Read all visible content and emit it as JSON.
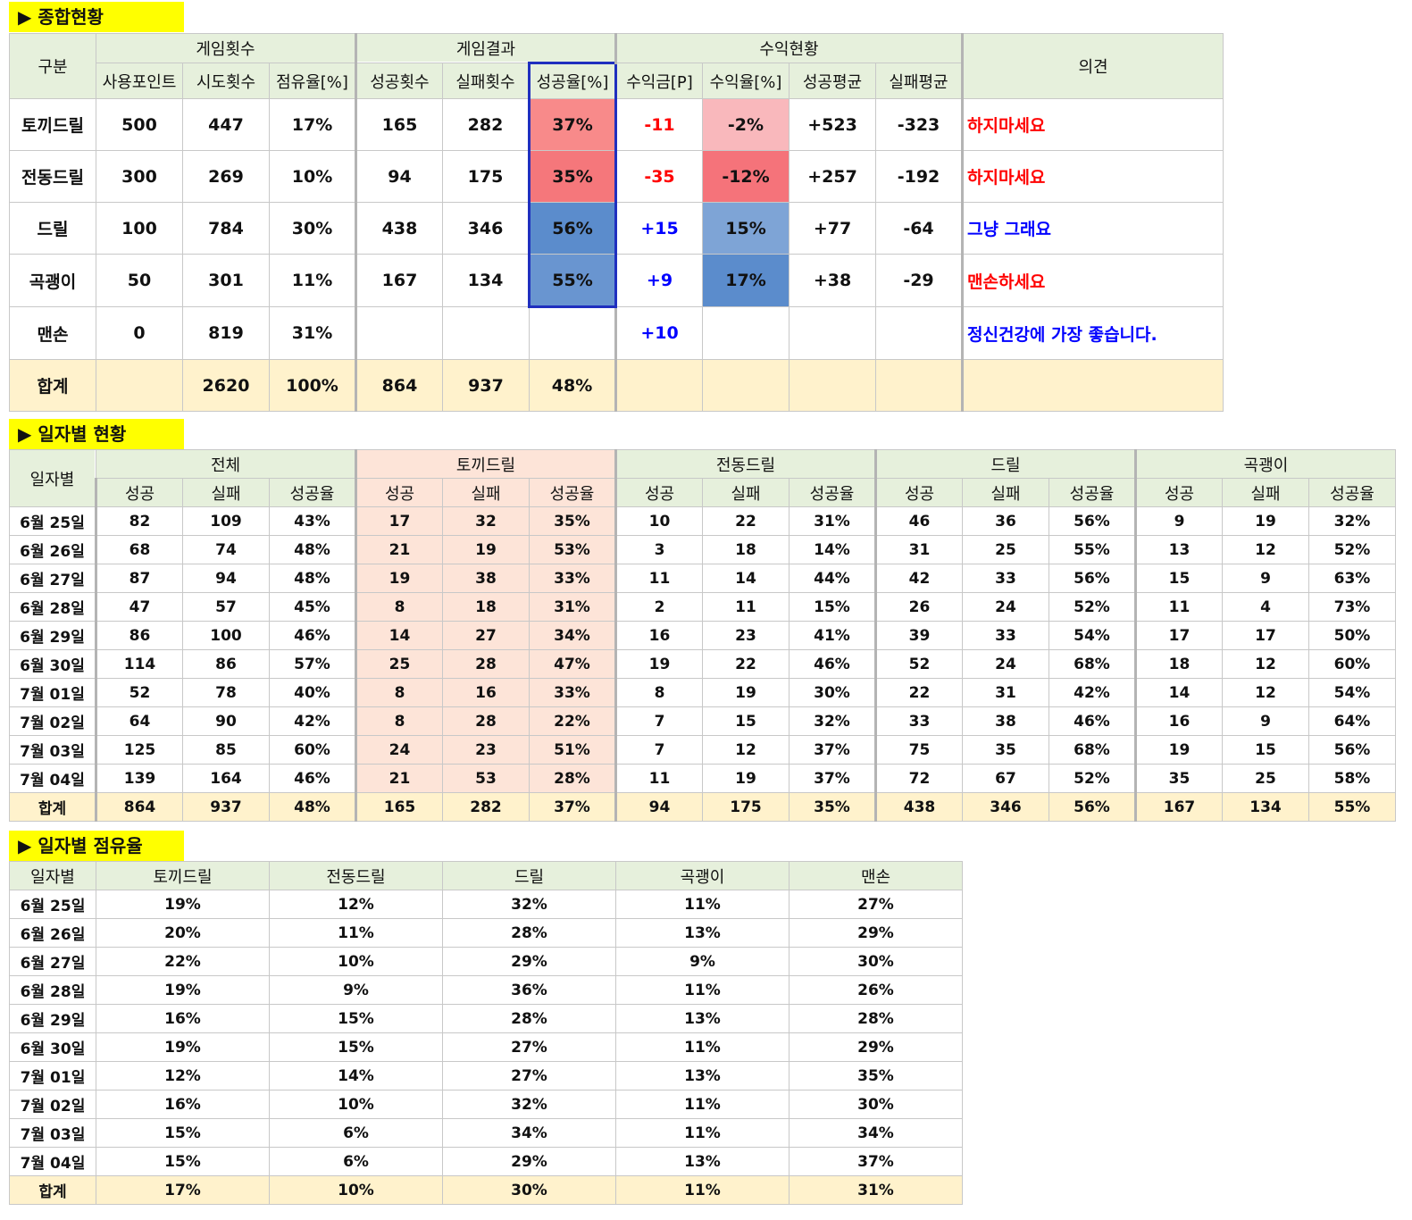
{
  "sections": {
    "summary_title": "▶ 종합현황",
    "daily_title": "▶ 일자별 현황",
    "share_title": "▶ 일자별 점유율"
  },
  "summary": {
    "col_category": "구분",
    "group_games": "게임횟수",
    "group_results": "게임결과",
    "group_profit": "수익현황",
    "col_opinion": "의견",
    "sub": [
      "사용포인트",
      "시도횟수",
      "점유율[%]",
      "성공횟수",
      "실패횟수",
      "성공율[%]",
      "수익금[P]",
      "수익율[%]",
      "성공평균",
      "실패평균"
    ],
    "rows": [
      {
        "name": "토끼드릴",
        "points": "500",
        "tries": "447",
        "share": "17%",
        "succ": "165",
        "fail": "282",
        "rate": "37%",
        "profit": "-11",
        "yield": "-2%",
        "savg": "+523",
        "favg": "-323",
        "opinion": "하지마세요"
      },
      {
        "name": "전동드릴",
        "points": "300",
        "tries": "269",
        "share": "10%",
        "succ": "94",
        "fail": "175",
        "rate": "35%",
        "profit": "-35",
        "yield": "-12%",
        "savg": "+257",
        "favg": "-192",
        "opinion": "하지마세요"
      },
      {
        "name": "드릴",
        "points": "100",
        "tries": "784",
        "share": "30%",
        "succ": "438",
        "fail": "346",
        "rate": "56%",
        "profit": "+15",
        "yield": "15%",
        "savg": "+77",
        "favg": "-64",
        "opinion": "그냥 그래요"
      },
      {
        "name": "곡괭이",
        "points": "50",
        "tries": "301",
        "share": "11%",
        "succ": "167",
        "fail": "134",
        "rate": "55%",
        "profit": "+9",
        "yield": "17%",
        "savg": "+38",
        "favg": "-29",
        "opinion": "맨손하세요"
      },
      {
        "name": "맨손",
        "points": "0",
        "tries": "819",
        "share": "31%",
        "succ": "",
        "fail": "",
        "rate": "",
        "profit": "+10",
        "yield": "",
        "savg": "",
        "favg": "",
        "opinion": "정신건강에 가장 좋습니다."
      }
    ],
    "total": {
      "name": "합계",
      "points": "",
      "tries": "2620",
      "share": "100%",
      "succ": "864",
      "fail": "937",
      "rate": "48%"
    },
    "colors": {
      "rate_red_1": "#f88a8a",
      "rate_red_2": "#f5777b",
      "rate_blue_1": "#5b8ccc",
      "rate_blue_2": "#6995d0",
      "yield_red_light": "#f9b8bc",
      "yield_red": "#f5737a",
      "yield_blue_light": "#7ea4d6",
      "yield_blue": "#5b8ccc"
    }
  },
  "daily": {
    "col_date": "일자별",
    "groups": [
      "전체",
      "토끼드릴",
      "전동드릴",
      "드릴",
      "곡괭이"
    ],
    "sub": [
      "성공",
      "실패",
      "성공율"
    ],
    "rows": [
      [
        "6월 25일",
        "82",
        "109",
        "43%",
        "17",
        "32",
        "35%",
        "10",
        "22",
        "31%",
        "46",
        "36",
        "56%",
        "9",
        "19",
        "32%"
      ],
      [
        "6월 26일",
        "68",
        "74",
        "48%",
        "21",
        "19",
        "53%",
        "3",
        "18",
        "14%",
        "31",
        "25",
        "55%",
        "13",
        "12",
        "52%"
      ],
      [
        "6월 27일",
        "87",
        "94",
        "48%",
        "19",
        "38",
        "33%",
        "11",
        "14",
        "44%",
        "42",
        "33",
        "56%",
        "15",
        "9",
        "63%"
      ],
      [
        "6월 28일",
        "47",
        "57",
        "45%",
        "8",
        "18",
        "31%",
        "2",
        "11",
        "15%",
        "26",
        "24",
        "52%",
        "11",
        "4",
        "73%"
      ],
      [
        "6월 29일",
        "86",
        "100",
        "46%",
        "14",
        "27",
        "34%",
        "16",
        "23",
        "41%",
        "39",
        "33",
        "54%",
        "17",
        "17",
        "50%"
      ],
      [
        "6월 30일",
        "114",
        "86",
        "57%",
        "25",
        "28",
        "47%",
        "19",
        "22",
        "46%",
        "52",
        "24",
        "68%",
        "18",
        "12",
        "60%"
      ],
      [
        "7월 01일",
        "52",
        "78",
        "40%",
        "8",
        "16",
        "33%",
        "8",
        "19",
        "30%",
        "22",
        "31",
        "42%",
        "14",
        "12",
        "54%"
      ],
      [
        "7월 02일",
        "64",
        "90",
        "42%",
        "8",
        "28",
        "22%",
        "7",
        "15",
        "32%",
        "33",
        "38",
        "46%",
        "16",
        "9",
        "64%"
      ],
      [
        "7월 03일",
        "125",
        "85",
        "60%",
        "24",
        "23",
        "51%",
        "7",
        "12",
        "37%",
        "75",
        "35",
        "68%",
        "19",
        "15",
        "56%"
      ],
      [
        "7월 04일",
        "139",
        "164",
        "46%",
        "21",
        "53",
        "28%",
        "11",
        "19",
        "37%",
        "72",
        "67",
        "52%",
        "35",
        "25",
        "58%"
      ]
    ],
    "total": [
      "합계",
      "864",
      "937",
      "48%",
      "165",
      "282",
      "37%",
      "94",
      "175",
      "35%",
      "438",
      "346",
      "56%",
      "167",
      "134",
      "55%"
    ]
  },
  "share": {
    "headers": [
      "일자별",
      "토끼드릴",
      "전동드릴",
      "드릴",
      "곡괭이",
      "맨손"
    ],
    "rows": [
      [
        "6월 25일",
        "19%",
        "12%",
        "32%",
        "11%",
        "27%"
      ],
      [
        "6월 26일",
        "20%",
        "11%",
        "28%",
        "13%",
        "29%"
      ],
      [
        "6월 27일",
        "22%",
        "10%",
        "29%",
        "9%",
        "30%"
      ],
      [
        "6월 28일",
        "19%",
        "9%",
        "36%",
        "11%",
        "26%"
      ],
      [
        "6월 29일",
        "16%",
        "15%",
        "28%",
        "13%",
        "28%"
      ],
      [
        "6월 30일",
        "19%",
        "15%",
        "27%",
        "11%",
        "29%"
      ],
      [
        "7월 01일",
        "12%",
        "14%",
        "27%",
        "13%",
        "35%"
      ],
      [
        "7월 02일",
        "16%",
        "10%",
        "32%",
        "11%",
        "30%"
      ],
      [
        "7월 03일",
        "15%",
        "6%",
        "34%",
        "11%",
        "34%"
      ],
      [
        "7월 04일",
        "15%",
        "6%",
        "29%",
        "13%",
        "37%"
      ]
    ],
    "total": [
      "합계",
      "17%",
      "10%",
      "30%",
      "11%",
      "31%"
    ]
  }
}
